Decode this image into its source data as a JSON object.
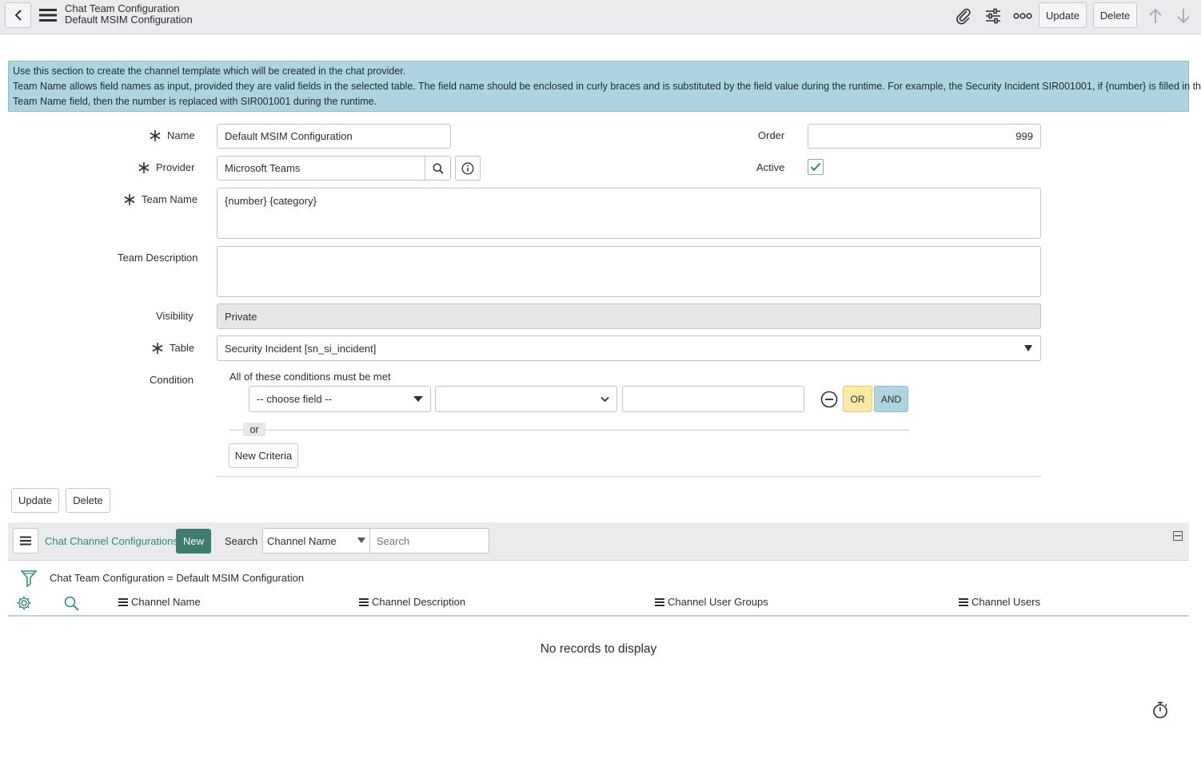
{
  "header": {
    "title": "Chat Team Configuration",
    "subtitle": "Default MSIM Configuration",
    "update_label": "Update",
    "delete_label": "Delete",
    "icons": [
      "back-icon",
      "menu-icon",
      "paperclip-icon",
      "sliders-icon",
      "more-icon",
      "arrow-up-icon",
      "arrow-down-icon"
    ]
  },
  "info": {
    "line1": "Use this section to create the channel template which will be created in the chat provider.",
    "line2": "Team Name allows field names as input, provided they are valid fields in the selected table. The field name should be enclosed in curly braces and is substituted by the field value during the runtime. For example, the Security Incident SIR001001, if {number} is filled in the",
    "line3": "Team Name field, then the number is replaced with SIR001001 during the runtime."
  },
  "form": {
    "name_label": "Name",
    "name_value": "Default MSIM Configuration",
    "order_label": "Order",
    "order_value": "999",
    "provider_label": "Provider",
    "provider_value": "Microsoft Teams",
    "active_label": "Active",
    "active_checked": true,
    "team_name_label": "Team Name",
    "team_name_value": "{number} {category}",
    "team_desc_label": "Team Description",
    "team_desc_value": "",
    "visibility_label": "Visibility",
    "visibility_value": "Private",
    "table_label": "Table",
    "table_value": "Security Incident [sn_si_incident]",
    "condition_label": "Condition",
    "condition_heading": "All of these conditions must be met",
    "choose_field": "-- choose field --",
    "operator_value": "",
    "condition_value": "",
    "or_label": "OR",
    "and_label": "AND",
    "or_divider": "or",
    "new_criteria_label": "New Criteria",
    "update_label": "Update",
    "delete_label": "Delete"
  },
  "related_list": {
    "title": "Chat Channel Configurations",
    "new_label": "New",
    "search_label": "Search",
    "search_field": "Channel Name",
    "search_placeholder": "Search",
    "filter_text": "Chat Team Configuration = Default MSIM Configuration",
    "columns": [
      "Channel Name",
      "Channel Description",
      "Channel User Groups",
      "Channel Users"
    ],
    "empty_text": "No records to display"
  },
  "colors": {
    "accent": "#2e8b7a",
    "new_button": "#3d7c6e",
    "info_bg": "#aed4df",
    "or_bg": "#fbe9a8"
  }
}
